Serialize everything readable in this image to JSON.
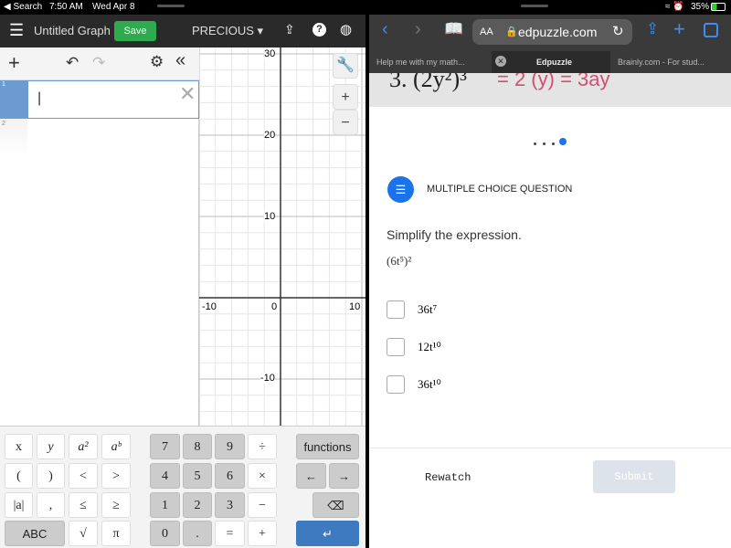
{
  "status": {
    "back": "◀ Search",
    "time": "7:50 AM",
    "date": "Wed Apr 8",
    "battery": "35%"
  },
  "desmos": {
    "title": "Untitled Graph",
    "save": "Save",
    "user": "PRECIOUS",
    "rows": [
      "1",
      "2"
    ],
    "input_value": "|",
    "axis": {
      "x_labels": [
        "-10",
        "0",
        "10"
      ],
      "y_labels": [
        "30",
        "20",
        "10",
        "-10"
      ]
    },
    "zoom_in": "+",
    "zoom_out": "−",
    "keypad": {
      "row1": [
        "x",
        "y",
        "a²",
        "aᵇ",
        "7",
        "8",
        "9",
        "÷",
        "functions"
      ],
      "row2": [
        "(",
        ")",
        "<",
        ">",
        "4",
        "5",
        "6",
        "×",
        "←",
        "→"
      ],
      "row3": [
        "|a|",
        ",",
        "≤",
        "≥",
        "1",
        "2",
        "3",
        "−"
      ],
      "row4": [
        "ABC",
        "√",
        "π",
        "0",
        ".",
        "=",
        "+"
      ]
    }
  },
  "safari": {
    "url": "edpuzzle.com",
    "aa": "AA",
    "tabs": [
      {
        "label": "Help me with my math..."
      },
      {
        "label": "Edpuzzle",
        "active": true
      },
      {
        "label": "Brainly.com - For stud..."
      }
    ]
  },
  "edpuzzle": {
    "bg_question": "3. (2y²)³",
    "bg_handwriting": "= 2 (y) = 3ay",
    "badge": "MULTIPLE CHOICE QUESTION",
    "prompt": "Simplify the expression.",
    "expression": "(6t⁵)²",
    "options": [
      "36t⁷",
      "12t¹⁰",
      "36t¹⁰"
    ],
    "rewatch": "Rewatch",
    "submit": "Submit",
    "accent": "#1a73e8"
  }
}
